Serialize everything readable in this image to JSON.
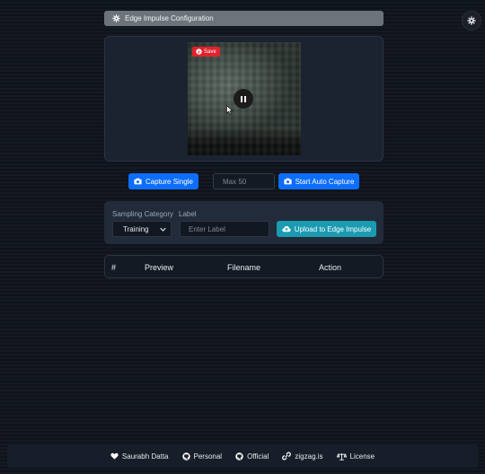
{
  "config_bar": {
    "title": "Edge Impulse Configuration",
    "icon": "gear-icon"
  },
  "video": {
    "save_badge": "Save",
    "state": "playing"
  },
  "capture": {
    "single_label": "Capture Single",
    "max_placeholder": "Max 50",
    "auto_label": "Start Auto Capture"
  },
  "sampling": {
    "category_label": "Sampling Category",
    "label_label": "Label",
    "category_value": "Training",
    "label_placeholder": "Enter Label",
    "upload_label": "Upload to Edge Impulse"
  },
  "table": {
    "headers": [
      "#",
      "Preview",
      "Filename",
      "Action"
    ]
  },
  "footer": {
    "links": [
      {
        "label": "Saurabh Datta",
        "icon": "heart-icon"
      },
      {
        "label": "Personal",
        "icon": "github-icon"
      },
      {
        "label": "Official",
        "icon": "github-icon"
      },
      {
        "label": "zigzag.is",
        "icon": "link-icon"
      },
      {
        "label": "License",
        "icon": "scale-icon"
      }
    ]
  },
  "colors": {
    "primary": "#0d6efd",
    "info": "#1a9bb1",
    "save_red": "#e0232d"
  }
}
